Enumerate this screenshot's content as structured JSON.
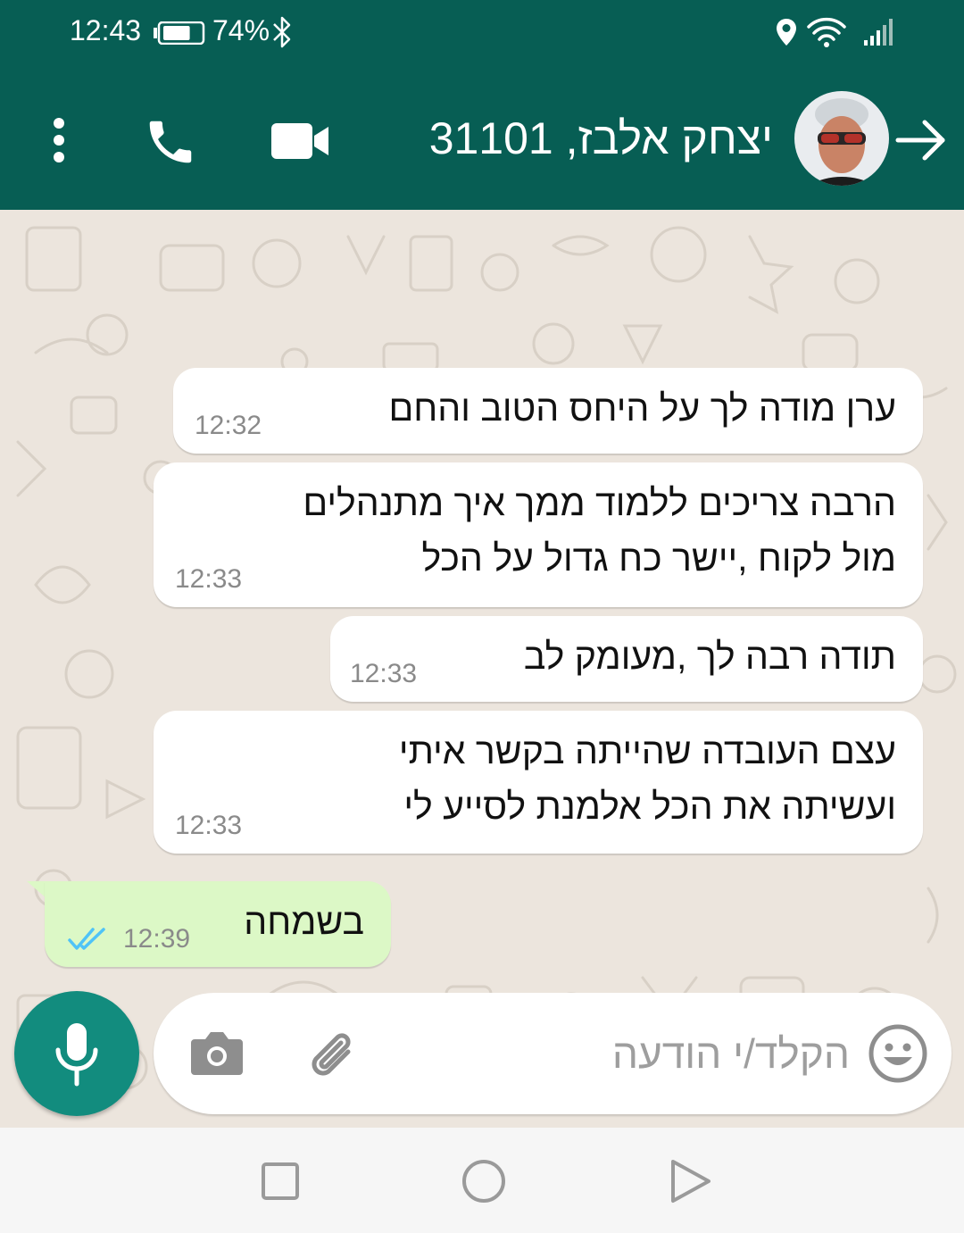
{
  "status_bar": {
    "time": "12:43",
    "battery_percent": "74%",
    "battery_level": 0.74
  },
  "header": {
    "contact_name": "יצחק אלבז, 31101",
    "icons": [
      "more-vert-icon",
      "phone-icon",
      "videocam-icon",
      "avatar",
      "arrow-back-icon"
    ]
  },
  "messages": [
    {
      "direction": "in",
      "lines": [
        "ערן מודה לך על היחס הטוב והחם"
      ],
      "time": "12:32"
    },
    {
      "direction": "in",
      "lines": [
        "הרבה צריכים ללמוד ממך איך מתנהלים",
        "מול לקוח ,יישר כח גדול על הכל"
      ],
      "time": "12:33"
    },
    {
      "direction": "in",
      "lines": [
        "תודה רבה לך ,מעומק לב"
      ],
      "time": "12:33"
    },
    {
      "direction": "in",
      "lines": [
        "עצם העובדה שהייתה בקשר איתי",
        "ועשיתה את הכל אלמנת לסייע לי"
      ],
      "time": "12:33"
    },
    {
      "direction": "out",
      "lines": [
        "בשמחה"
      ],
      "time": "12:39",
      "status": "read"
    }
  ],
  "composer": {
    "placeholder": "הקלד/י הודעה"
  },
  "colors": {
    "header": "#075e54",
    "accent": "#128c7e",
    "outgoing_bubble": "#dcf8c6",
    "read_ticks": "#4fc3f7",
    "chat_background": "#ece5dd"
  }
}
